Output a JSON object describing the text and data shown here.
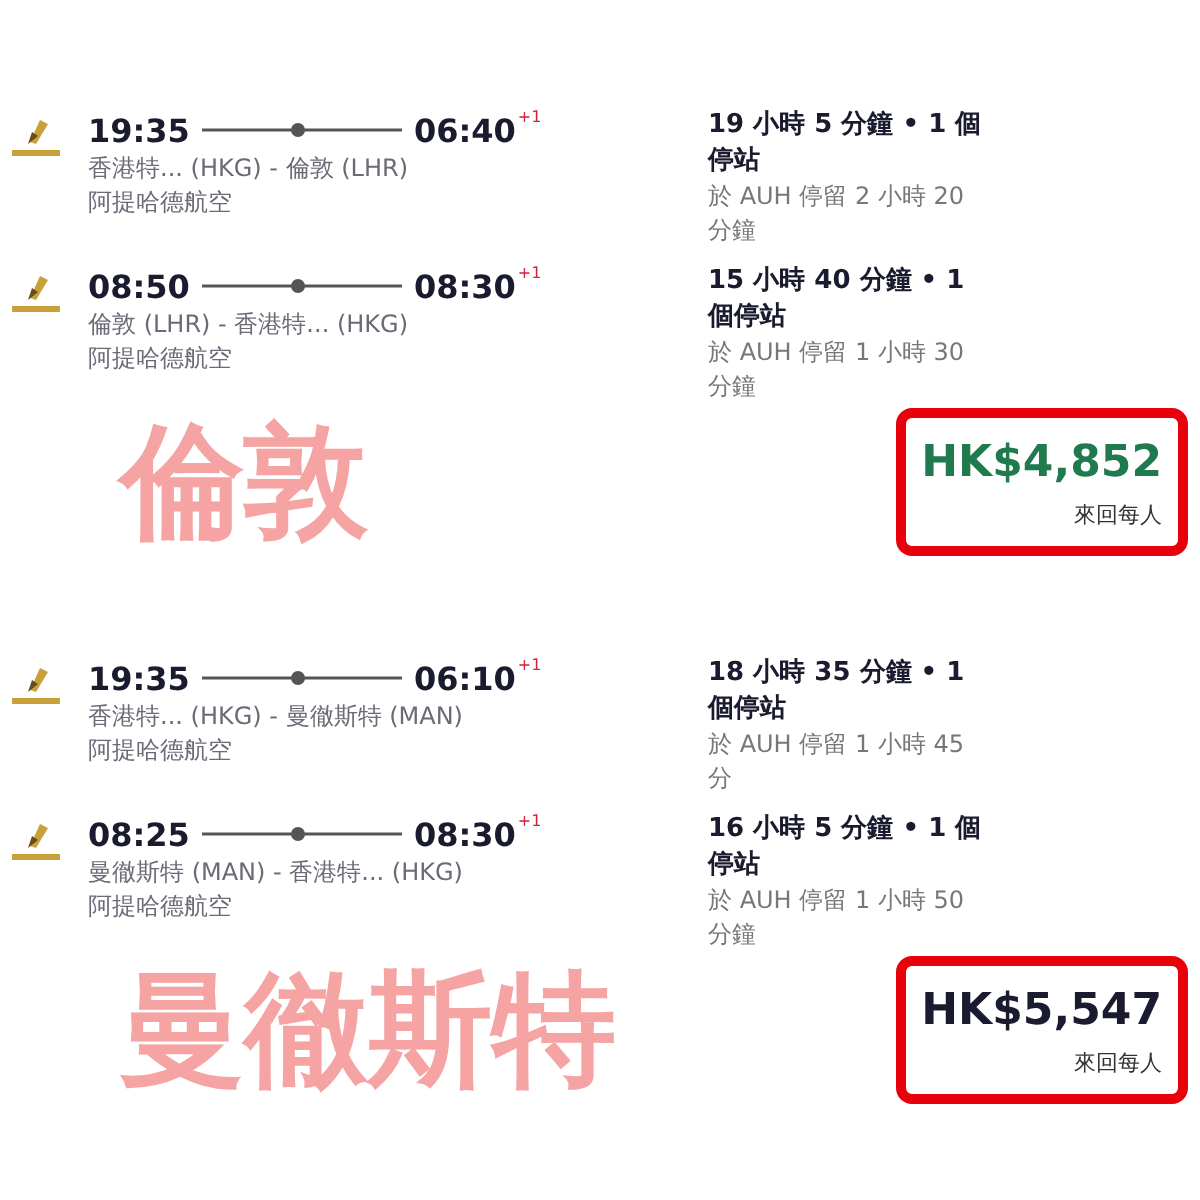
{
  "results": [
    {
      "annotation": "倫敦",
      "legs": [
        {
          "depart": "19:35",
          "arrive": "06:40",
          "day_offset": "+1",
          "route": "香港特... (HKG) - 倫敦 (LHR)",
          "airline": "阿提哈德航空",
          "duration": "19 小時 5 分鐘 • 1 個停站",
          "layover": "於 AUH 停留 2 小時 20 分鐘"
        },
        {
          "depart": "08:50",
          "arrive": "08:30",
          "day_offset": "+1",
          "route": "倫敦 (LHR) - 香港特... (HKG)",
          "airline": "阿提哈德航空",
          "duration": "15 小時 40 分鐘 • 1 個停站",
          "layover": "於 AUH 停留 1 小時 30 分鐘"
        }
      ],
      "price": "HK$4,852",
      "price_note": "來回每人",
      "best": true
    },
    {
      "annotation": "曼徹斯特",
      "legs": [
        {
          "depart": "19:35",
          "arrive": "06:10",
          "day_offset": "+1",
          "route": "香港特... (HKG) - 曼徹斯特 (MAN)",
          "airline": "阿提哈德航空",
          "duration": "18 小時 35 分鐘 • 1 個停站",
          "layover": "於 AUH 停留 1 小時 45 分"
        },
        {
          "depart": "08:25",
          "arrive": "08:30",
          "day_offset": "+1",
          "route": "曼徹斯特 (MAN) - 香港特... (HKG)",
          "airline": "阿提哈德航空",
          "duration": "16 小時 5 分鐘 • 1 個停站",
          "layover": "於 AUH 停留 1 小時 50 分鐘"
        }
      ],
      "price": "HK$5,547",
      "price_note": "來回每人",
      "best": false
    }
  ]
}
